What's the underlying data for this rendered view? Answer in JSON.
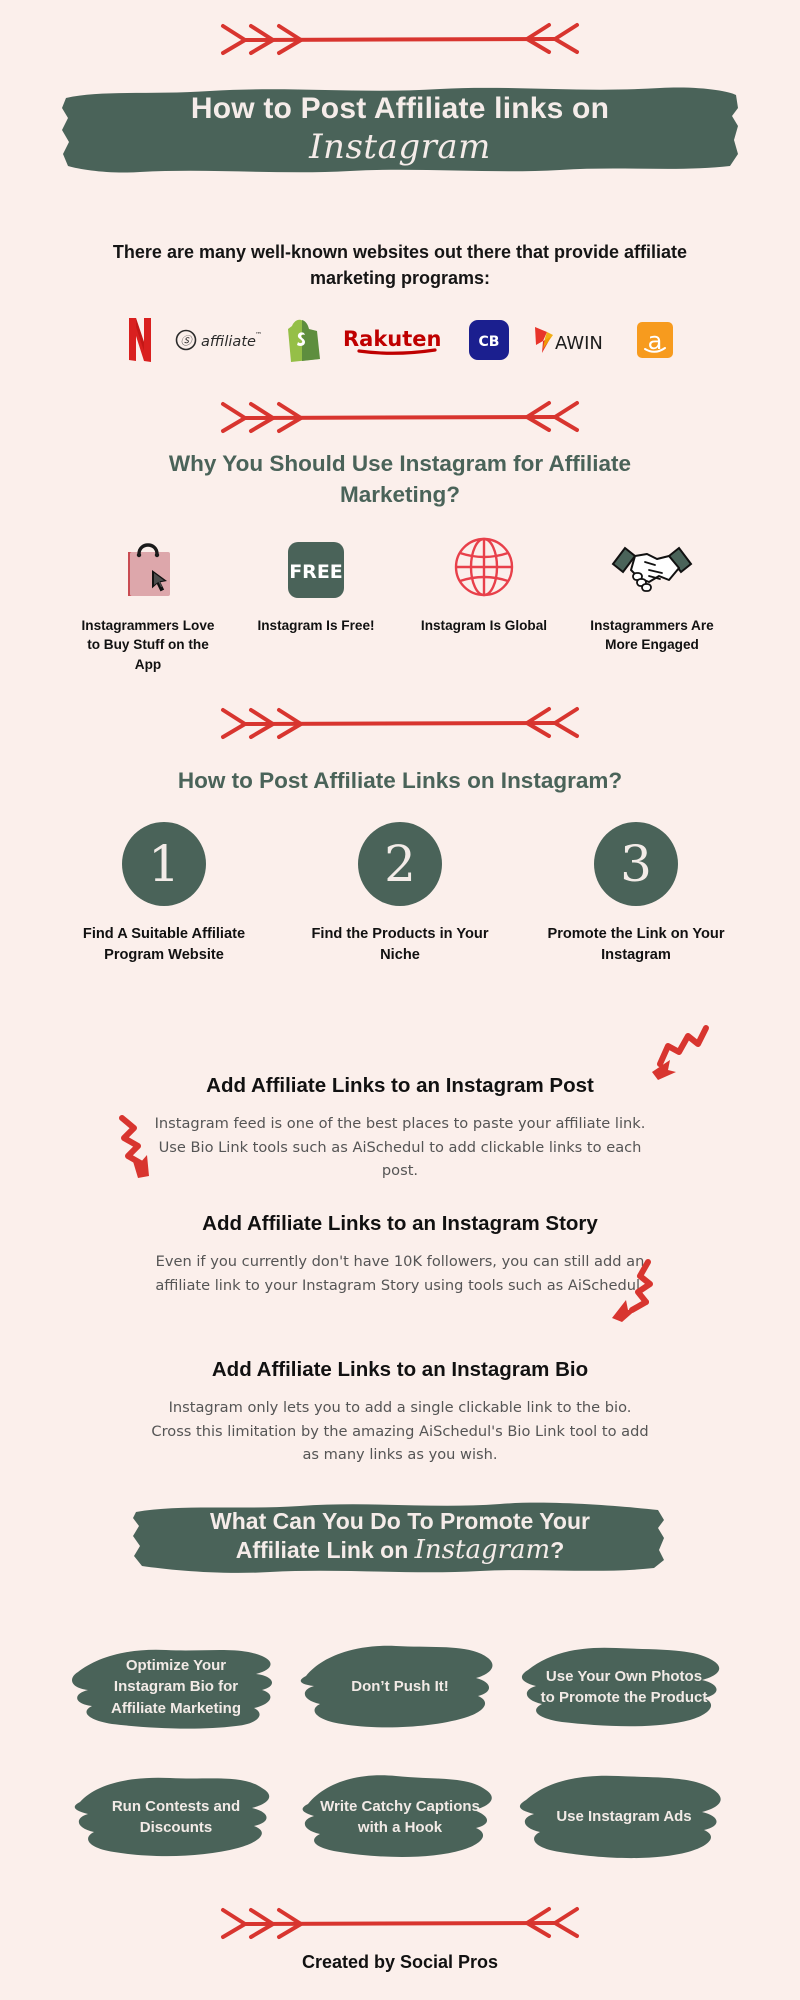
{
  "theme": {
    "background": "#fbefeb",
    "green": "#4a6359",
    "red": "#d8352f",
    "cream": "#f3ece8",
    "body_text": "#555555",
    "heading_text": "#111111"
  },
  "header": {
    "title_line1": "How to Post Affiliate links on",
    "title_script": "Instagram"
  },
  "intro": {
    "lead": "There are many well-known websites out there that provide affiliate marketing programs:"
  },
  "logos": [
    {
      "name": "netflix-logo",
      "label": "Netflix"
    },
    {
      "name": "cj-affiliate-logo",
      "label": "affiliate"
    },
    {
      "name": "shopify-logo",
      "label": "Shopify"
    },
    {
      "name": "rakuten-logo",
      "label": "Rakuten"
    },
    {
      "name": "clickbank-logo",
      "label": "CB"
    },
    {
      "name": "awin-logo",
      "label": "AWIN"
    },
    {
      "name": "amazon-logo",
      "label": "Amazon"
    }
  ],
  "why": {
    "heading": "Why You Should Use Instagram for Affiliate Marketing?",
    "items": [
      {
        "icon": "shopping-bag-icon",
        "caption": "Instagrammers Love to Buy Stuff on the App"
      },
      {
        "icon": "free-badge-icon",
        "icon_text": "FREE",
        "caption": "Instagram Is Free!"
      },
      {
        "icon": "globe-icon",
        "caption": "Instagram Is Global"
      },
      {
        "icon": "handshake-icon",
        "caption": "Instagrammers Are More Engaged"
      }
    ]
  },
  "how": {
    "heading": "How to Post Affiliate Links on Instagram?",
    "steps": [
      {
        "number": "1",
        "caption": "Find A Suitable Affiliate Program Website"
      },
      {
        "number": "2",
        "caption": "Find the Products in Your Niche"
      },
      {
        "number": "3",
        "caption": "Promote the Link on Your Instagram"
      }
    ]
  },
  "methods": [
    {
      "title": "Add Affiliate Links to an Instagram Post",
      "body": "Instagram feed is one of the best places to paste your affiliate link. Use Bio Link tools such as AiSchedul to add clickable links to each post."
    },
    {
      "title": "Add Affiliate Links to an Instagram Story",
      "body": "Even if you currently don't have 10K followers, you can still add an affiliate link to your Instagram Story using tools such as AiSchedul."
    },
    {
      "title": "Add Affiliate Links to an Instagram Bio",
      "body": "Instagram only lets you to add a single clickable link to the bio. Cross this limitation by the amazing AiSchedul's Bio Link tool to add as many links as you wish."
    }
  ],
  "promote": {
    "banner_line1": "What Can You Do To Promote Your",
    "banner_line2_pre": "Affiliate Link on ",
    "banner_line2_script": "Instagram",
    "banner_line2_post": "?",
    "tips": [
      "Optimize Your Instagram Bio for Affiliate Marketing",
      "Don’t Push It!",
      "Use Your Own Photos to Promote the Product",
      "Run Contests and Discounts",
      "Write Catchy Captions with a Hook",
      "Use Instagram Ads"
    ]
  },
  "footer": {
    "credit": "Created by Social Pros"
  }
}
